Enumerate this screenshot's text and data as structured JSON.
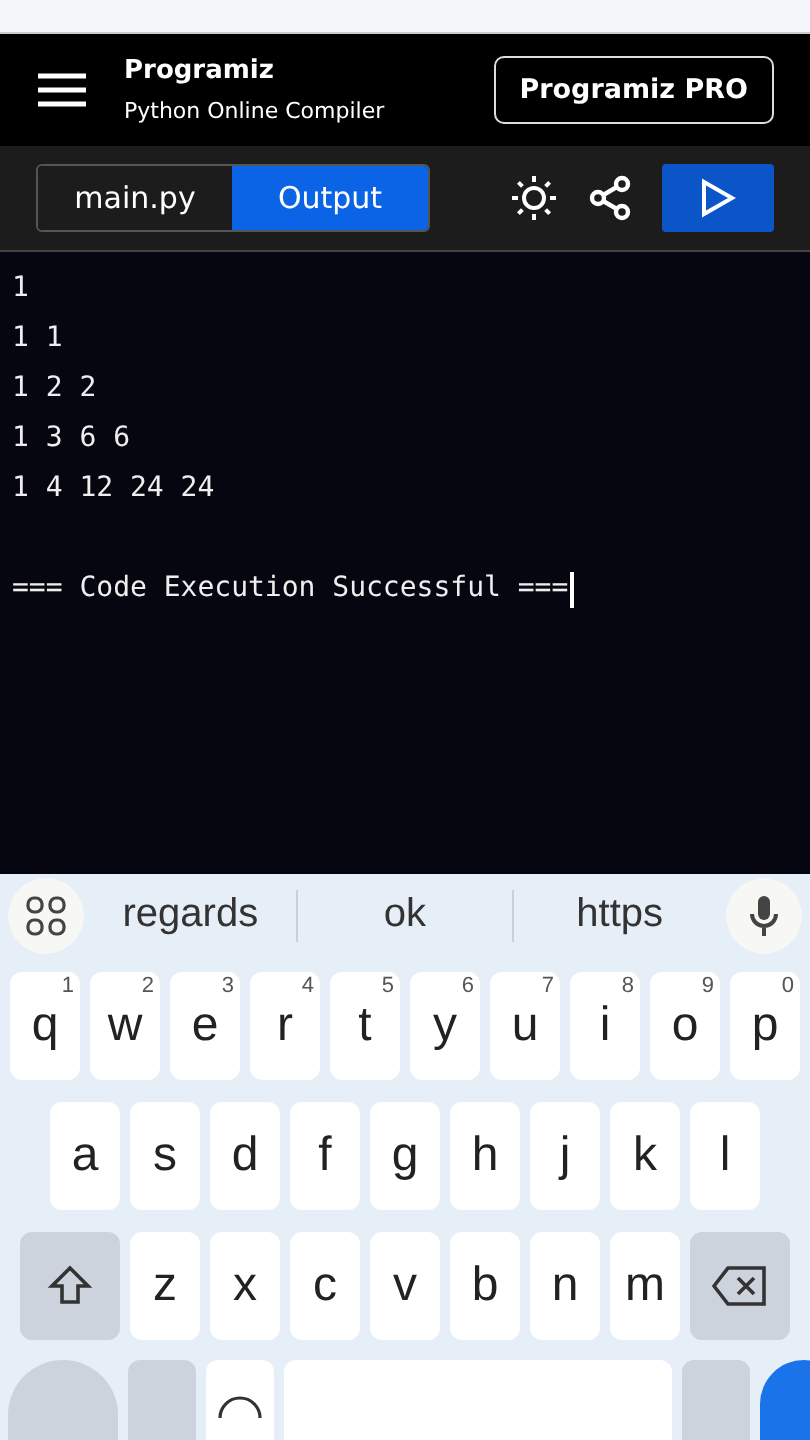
{
  "header": {
    "brand": "Programiz",
    "subtitle": "Python Online Compiler",
    "pro_button": "Programiz PRO"
  },
  "tabs": [
    {
      "label": "main.py",
      "selected": false
    },
    {
      "label": "Output",
      "selected": true
    }
  ],
  "output": {
    "lines": [
      "1",
      "1 1",
      "1 2 2",
      "1 3 6 6",
      "1 4 12 24 24"
    ],
    "status": "=== Code Execution Successful ===",
    "cursor": true
  },
  "keyboard": {
    "suggestions": [
      "regards",
      "ok",
      "https"
    ],
    "rows": [
      [
        {
          "key": "q",
          "hint": "1"
        },
        {
          "key": "w",
          "hint": "2"
        },
        {
          "key": "e",
          "hint": "3"
        },
        {
          "key": "r",
          "hint": "4"
        },
        {
          "key": "t",
          "hint": "5"
        },
        {
          "key": "y",
          "hint": "6"
        },
        {
          "key": "u",
          "hint": "7"
        },
        {
          "key": "i",
          "hint": "8"
        },
        {
          "key": "o",
          "hint": "9"
        },
        {
          "key": "p",
          "hint": "0"
        }
      ],
      [
        {
          "key": "a"
        },
        {
          "key": "s"
        },
        {
          "key": "d"
        },
        {
          "key": "f"
        },
        {
          "key": "g"
        },
        {
          "key": "h"
        },
        {
          "key": "j"
        },
        {
          "key": "k"
        },
        {
          "key": "l"
        }
      ],
      [
        {
          "key": "z"
        },
        {
          "key": "x"
        },
        {
          "key": "c"
        },
        {
          "key": "v"
        },
        {
          "key": "b"
        },
        {
          "key": "n"
        },
        {
          "key": "m"
        }
      ]
    ]
  }
}
